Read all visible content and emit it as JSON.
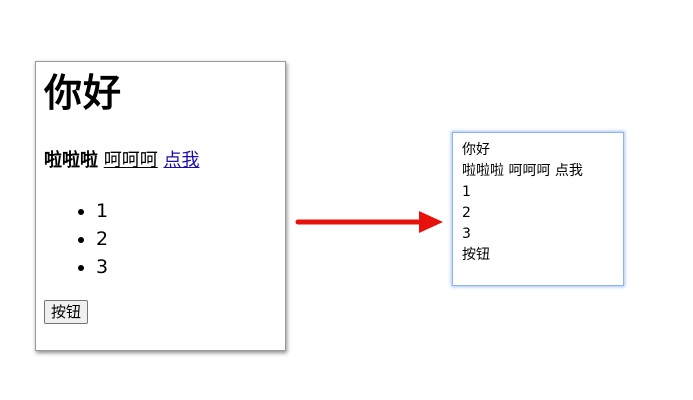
{
  "left": {
    "heading": "你好",
    "bold_text": "啦啦啦",
    "underline_text": "呵呵呵",
    "link_text": "点我",
    "list_items": [
      "1",
      "2",
      "3"
    ],
    "button_label": "按钮"
  },
  "right": {
    "lines": [
      "你好",
      "啦啦啦 呵呵呵 点我",
      "1",
      "2",
      "3",
      "按钮"
    ]
  },
  "arrow_color": "#e8120c"
}
